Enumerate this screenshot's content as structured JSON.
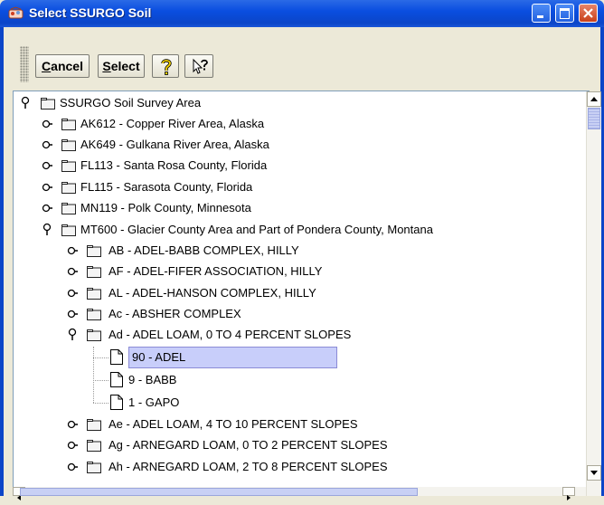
{
  "window": {
    "title": "Select SSURGO Soil"
  },
  "toolbar": {
    "cancel_first": "C",
    "cancel_rest": "ancel",
    "select_first": "S",
    "select_rest": "elect",
    "help_icon": "question-mark-icon",
    "context_help_icon": "arrow-question-icon"
  },
  "tree": {
    "root": "SSURGO Soil Survey Area",
    "areas": [
      "AK612 - Copper River Area, Alaska",
      "AK649 - Gulkana River Area, Alaska",
      "FL113 - Santa Rosa County, Florida",
      "FL115 - Sarasota County, Florida",
      "MN119 - Polk County, Minnesota",
      "MT600 - Glacier County Area and Part of Pondera County, Montana"
    ],
    "map_units": [
      "AB - ADEL-BABB COMPLEX, HILLY",
      "AF - ADEL-FIFER ASSOCIATION, HILLY",
      "AL - ADEL-HANSON COMPLEX, HILLY",
      "Ac - ABSHER COMPLEX",
      "Ad - ADEL LOAM, 0 TO 4 PERCENT SLOPES"
    ],
    "components": [
      "90 - ADEL",
      "9 - BABB",
      "1 - GAPO"
    ],
    "more_units": [
      "Ae - ADEL LOAM, 4 TO 10 PERCENT SLOPES",
      "Ag - ARNEGARD LOAM, 0 TO 2 PERCENT SLOPES",
      "Ah - ARNEGARD LOAM, 2 TO 8 PERCENT SLOPES"
    ]
  }
}
